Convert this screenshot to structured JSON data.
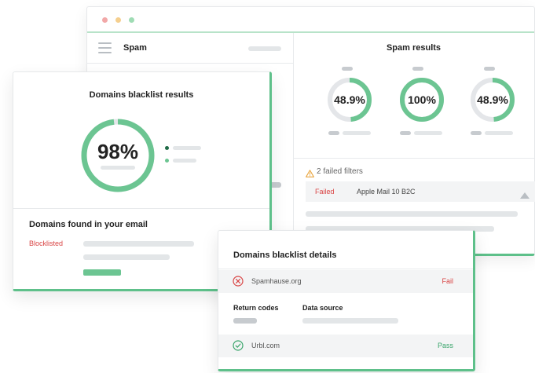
{
  "spam_window": {
    "sidebar_title": "Spam",
    "results_title": "Spam results",
    "gauges": [
      {
        "label": "48.9%",
        "fraction": 0.489
      },
      {
        "label": "100%",
        "fraction": 1.0
      },
      {
        "label": "48.9%",
        "fraction": 0.489
      }
    ],
    "failed_filters": "2 failed filters",
    "failed_row": {
      "status": "Failed",
      "client": "Apple Mail 10  B2C"
    },
    "window_dots": [
      "#f2a8a8",
      "#f5cf8e",
      "#9fdcb4"
    ]
  },
  "blacklist_card": {
    "title": "Domains blacklist results",
    "score_label": "98%",
    "score_fraction": 0.98,
    "legend_colors": [
      "#1f6b47",
      "#6cc592"
    ],
    "found_title": "Domains found in your email",
    "blocklisted_label": "Blocklisted"
  },
  "details_card": {
    "title": "Domains blacklist details",
    "rows": [
      {
        "domain": "Spamhause.org",
        "status": "Fail",
        "icon": "x-circle-icon"
      },
      {
        "domain": "Urbl.com",
        "status": "Pass",
        "icon": "check-circle-icon"
      }
    ],
    "return_codes_label": "Return codes",
    "data_source_label": "Data source"
  },
  "colors": {
    "accent": "#5ec08a",
    "gauge_track": "#e4e6e9",
    "fail": "#d94545",
    "pass": "#3aa56b"
  }
}
